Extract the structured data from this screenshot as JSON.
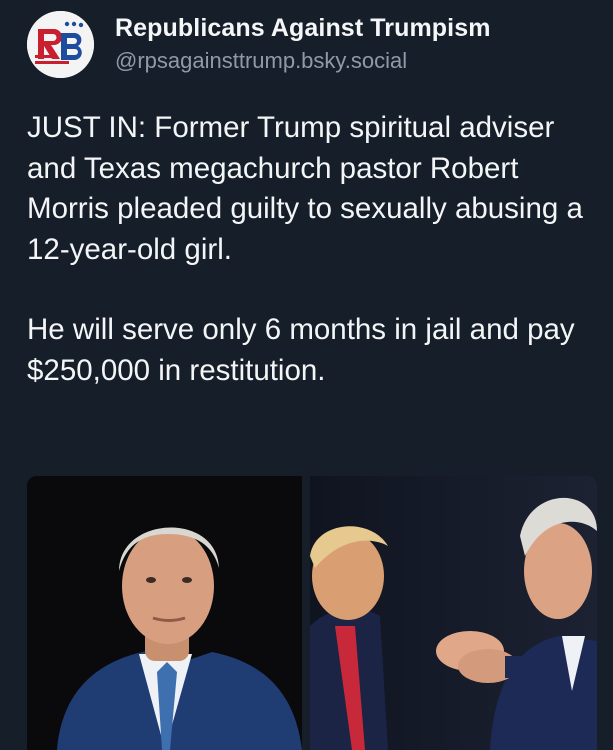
{
  "post": {
    "display_name": "Republicans Against Trumpism",
    "handle": "@rpsagainsttrump.bsky.social",
    "avatar_icon": "rb-logo-icon",
    "paragraphs": [
      "JUST IN: Former Trump spiritual adviser and Texas megachurch pastor Robert Morris pleaded guilty to sexually abusing a 12-year-old girl.",
      "He will serve only 6 months in jail and pay $250,000 in restitution."
    ]
  },
  "colors": {
    "background": "#161f29",
    "text": "#f4f5f7",
    "handle": "#8f9aa8",
    "logo_red": "#c8202f",
    "logo_blue": "#1d4e9e"
  }
}
